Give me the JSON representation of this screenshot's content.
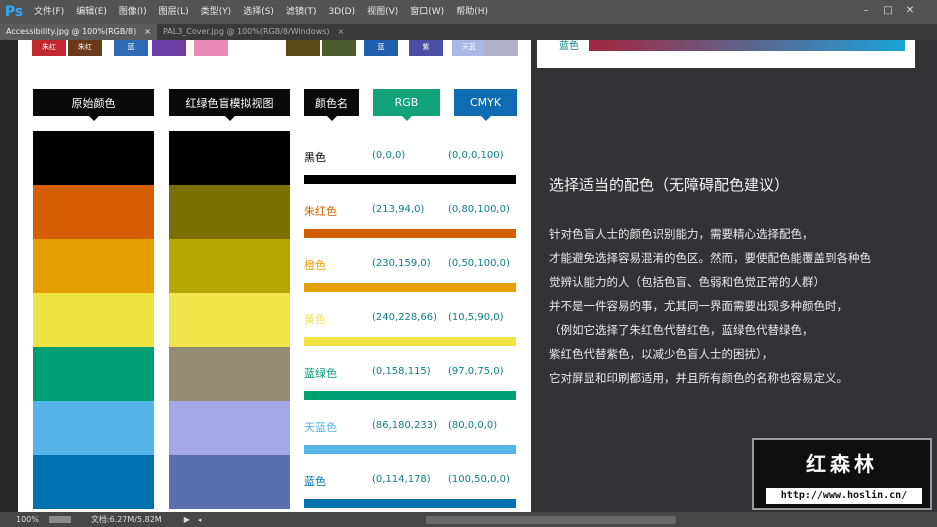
{
  "app": {
    "logo": "Ps"
  },
  "menubar": {
    "items": [
      "文件(F)",
      "编辑(E)",
      "图像(I)",
      "图层(L)",
      "类型(Y)",
      "选择(S)",
      "滤镜(T)",
      "3D(D)",
      "视图(V)",
      "窗口(W)",
      "帮助(H)"
    ]
  },
  "window_controls": {
    "minimize": "–",
    "maximize": "□",
    "close": "✕"
  },
  "tabs": [
    {
      "label": "Accessibility.jpg @ 100%(RGB/8)",
      "close": "×",
      "active": true
    },
    {
      "label": "PAL3_Cover.jpg @ 100%(RGB/8/Windows)",
      "close": "×",
      "active": false
    }
  ],
  "top_swatches": [
    {
      "label": "朱红",
      "color": "#c0282e"
    },
    {
      "label": "朱红",
      "color": "#6b3a1a"
    },
    {
      "label": "蓝",
      "color": "#2e6bb4"
    },
    {
      "label": "",
      "color": "#6b3ea6"
    },
    {
      "label": "",
      "color": "#e88ab5"
    },
    {
      "label": "",
      "color": "#5a4a1a"
    },
    {
      "label": "",
      "color": "#4d5c2e"
    },
    {
      "label": "蓝",
      "color": "#1f5fb0"
    },
    {
      "label": "紫",
      "color": "#4a4ea5"
    },
    {
      "label": "天蓝",
      "color": "#a9b8e6"
    },
    {
      "label": "",
      "color": "#b0b0c8"
    }
  ],
  "headers": {
    "original": "原始颜色",
    "simulated": "红绿色盲模拟视图",
    "name": "颜色名",
    "rgb": "RGB",
    "cmyk": "CMYK"
  },
  "colors": [
    {
      "name": "黑色",
      "rgb": "(0,0,0)",
      "cmyk": "(0,0,0,100)",
      "swatch": "#000000",
      "simulated": "#000000",
      "name_color": "#000000"
    },
    {
      "name": "朱红色",
      "rgb": "(213,94,0)",
      "cmyk": "(0,80,100,0)",
      "swatch": "#d55e00",
      "simulated": "#7a7000",
      "name_color": "#d55e00"
    },
    {
      "name": "橙色",
      "rgb": "(230,159,0)",
      "cmyk": "(0,50,100,0)",
      "swatch": "#e69f00",
      "simulated": "#b8a600",
      "name_color": "#e69f00"
    },
    {
      "name": "黄色",
      "rgb": "(240,228,66)",
      "cmyk": "(10,5,90,0)",
      "swatch": "#f0e442",
      "simulated": "#f2e54c",
      "name_color": "#f0e442"
    },
    {
      "name": "蓝绿色",
      "rgb": "(0,158,115)",
      "cmyk": "(97,0,75,0)",
      "swatch": "#009e73",
      "simulated": "#948c72",
      "name_color": "#009e73"
    },
    {
      "name": "天蓝色",
      "rgb": "(86,180,233)",
      "cmyk": "(80,0,0,0)",
      "swatch": "#56b4e9",
      "simulated": "#a3a8e6",
      "name_color": "#56b4e9"
    },
    {
      "name": "蓝色",
      "rgb": "(0,114,178)",
      "cmyk": "(100,50,0,0)",
      "swatch": "#0072b2",
      "simulated": "#5b6eb0",
      "name_color": "#0072b2"
    }
  ],
  "right_top": {
    "label": "蓝色",
    "gradient_from": "#a3243f",
    "gradient_to": "#1aa3d8"
  },
  "article": {
    "title": "选择适当的配色（无障碍配色建议）",
    "lines": [
      "针对色盲人士的颜色识别能力，需要精心选择配色，",
      "才能避免选择容易混淆的色区。然而，要使配色能覆盖到各种色",
      "觉辨认能力的人（包括色盲、色弱和色觉正常的人群）",
      "并不是一件容易的事，尤其同一界面需要出现多种颜色时，",
      "（例如它选择了朱红色代替红色，蓝绿色代替绿色，",
      "紫红色代替紫色，以减少色盲人士的困扰），",
      "它对屏显和印刷都适用，并且所有颜色的名称也容易定义。"
    ]
  },
  "status": {
    "zoom": "100%",
    "doc": "文档:6.27M/5.82M"
  },
  "watermark": {
    "title": "红森林",
    "url": "http://www.hoslin.cn/"
  }
}
